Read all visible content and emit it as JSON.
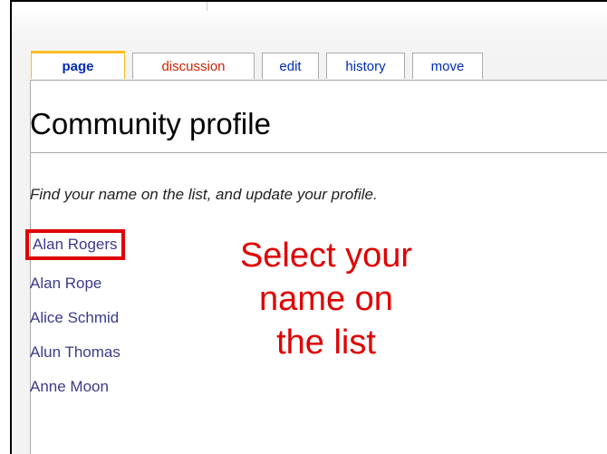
{
  "tabs": [
    {
      "label": "page",
      "selected": true
    },
    {
      "label": "discussion",
      "selected": false,
      "new": true
    },
    {
      "label": "edit",
      "selected": false
    },
    {
      "label": "history",
      "selected": false
    },
    {
      "label": "move",
      "selected": false
    }
  ],
  "title": "Community profile",
  "intro": "Find your name on the list, and update your profile.",
  "names": [
    "Alan Rogers",
    "Alan Rope",
    "Alice Schmid",
    "Alun Thomas",
    "Anne Moon"
  ],
  "callout": {
    "lines": [
      "Select your",
      "name on",
      "the list"
    ],
    "color": "#e00000"
  },
  "colors": {
    "tab_selected_border": "#fabd23",
    "link": "#3a3a8c",
    "highlight_box": "#e00000"
  }
}
